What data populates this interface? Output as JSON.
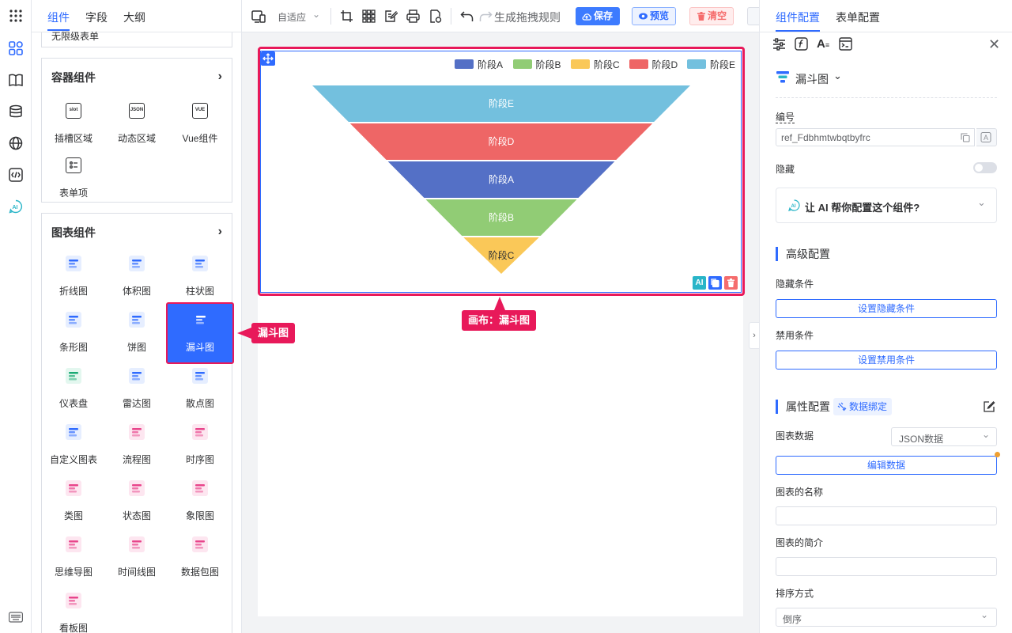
{
  "panel": {
    "tabs": [
      "组件",
      "字段",
      "大纲"
    ],
    "cut_item": "无限级表单",
    "container_card": {
      "title": "容器组件",
      "items": [
        "插槽区域",
        "动态区域",
        "Vue组件",
        "表单项"
      ],
      "icon_texts": [
        "slot",
        "JSON",
        "VUE"
      ]
    },
    "chart_card": {
      "title": "图表组件",
      "items": [
        "折线图",
        "体积图",
        "柱状图",
        "条形图",
        "饼图",
        "漏斗图",
        "仪表盘",
        "雷达图",
        "散点图",
        "自定义图表",
        "流程图",
        "时序图",
        "类图",
        "状态图",
        "象限图",
        "思维导图",
        "时间线图",
        "数据包图",
        "看板图"
      ]
    }
  },
  "toolbar": {
    "layout_label": "自适应",
    "rule_label": "生成拖拽规则",
    "save": "保存",
    "preview": "预览",
    "clear": "清空"
  },
  "canvas": {
    "callout_item": "漏斗图",
    "callout_canvas": "画布：漏斗图"
  },
  "chart_data": {
    "type": "funnel",
    "legend": [
      "阶段A",
      "阶段B",
      "阶段C",
      "阶段D",
      "阶段E"
    ],
    "order": "descending",
    "stages": [
      "阶段E",
      "阶段D",
      "阶段A",
      "阶段B",
      "阶段C"
    ],
    "colors": {
      "阶段A": "#5470c6",
      "阶段B": "#91cc75",
      "阶段C": "#fac858",
      "阶段D": "#ee6666",
      "阶段E": "#73c0de"
    }
  },
  "chart_tools": [
    "AI",
    "copy-icon",
    "delete-icon"
  ],
  "right": {
    "tabs": [
      "组件配置",
      "表单配置"
    ],
    "component_type": "漏斗图",
    "id_label": "编号",
    "id_value": "ref_Fdbhmtwbqtbyfrc",
    "hide_label": "隐藏",
    "ai_prompt": "让 AI 帮你配置这个组件?",
    "advanced": "高级配置",
    "hide_cond_label": "隐藏条件",
    "hide_cond_btn": "设置隐藏条件",
    "disable_cond_label": "禁用条件",
    "disable_cond_btn": "设置禁用条件",
    "props_title": "属性配置",
    "data_binding": "数据绑定",
    "chart_data_label": "图表数据",
    "chart_data_select": "JSON数据",
    "edit_data_btn": "编辑数据",
    "chart_name_label": "图表的名称",
    "chart_desc_label": "图表的简介",
    "sort_label": "排序方式",
    "sort_value": "倒序"
  }
}
